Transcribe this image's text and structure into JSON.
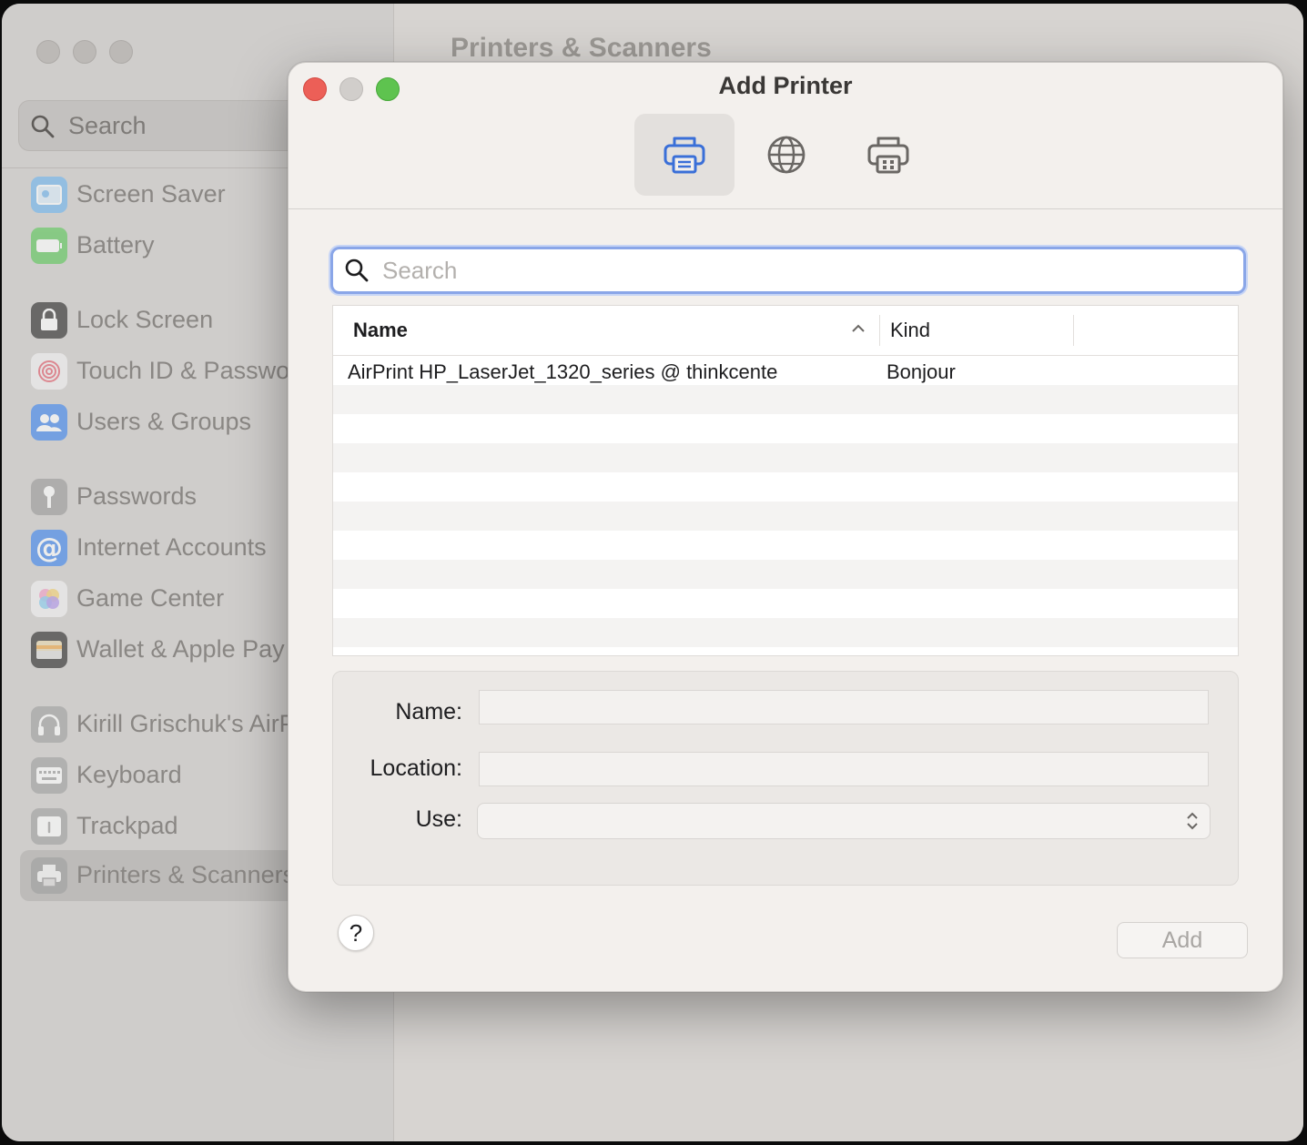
{
  "background_window": {
    "title": "Printers & Scanners",
    "sidebar": {
      "search_placeholder": "Search",
      "items": [
        {
          "label": "Screen Saver",
          "icon": "screen-saver-icon",
          "color": "#6fb6f0"
        },
        {
          "label": "Battery",
          "icon": "battery-icon",
          "color": "#5cc85a"
        },
        {
          "label": "Lock Screen",
          "icon": "lock-icon",
          "color": "#2b2b2b"
        },
        {
          "label": "Touch ID & Passwo",
          "icon": "fingerprint-icon",
          "color": "#f2f2f2"
        },
        {
          "label": "Users & Groups",
          "icon": "users-icon",
          "color": "#3e86f0"
        },
        {
          "label": "Passwords",
          "icon": "key-icon",
          "color": "#9a9a9a"
        },
        {
          "label": "Internet Accounts",
          "icon": "at-icon",
          "color": "#3e86f0"
        },
        {
          "label": "Game Center",
          "icon": "game-center-icon",
          "color": "#f2f2f2"
        },
        {
          "label": "Wallet & Apple Pay",
          "icon": "wallet-icon",
          "color": "#2b2b2b"
        },
        {
          "label": "Kirill Grischuk's AirP",
          "icon": "headphones-icon",
          "color": "#a0a0a0"
        },
        {
          "label": "Keyboard",
          "icon": "keyboard-icon",
          "color": "#a0a0a0"
        },
        {
          "label": "Trackpad",
          "icon": "trackpad-icon",
          "color": "#a0a0a0"
        },
        {
          "label": "Printers & Scanners",
          "icon": "printer-icon",
          "color": "#a0a0a0",
          "selected": true
        }
      ]
    }
  },
  "dialog": {
    "title": "Add Printer",
    "toolbar": [
      {
        "name": "default",
        "icon": "printer-default-icon",
        "active": true
      },
      {
        "name": "ip",
        "icon": "globe-icon",
        "active": false
      },
      {
        "name": "windows",
        "icon": "windows-printer-icon",
        "active": false
      }
    ],
    "search_placeholder": "Search",
    "table": {
      "columns": [
        "Name",
        "Kind"
      ],
      "rows": [
        {
          "name": "AirPrint HP_LaserJet_1320_series @ thinkcente",
          "kind": "Bonjour"
        }
      ]
    },
    "form": {
      "name_label": "Name:",
      "location_label": "Location:",
      "use_label": "Use:",
      "name_value": "",
      "location_value": "",
      "use_value": ""
    },
    "help_label": "?",
    "add_label": "Add",
    "accent_color": "#3a6fd8"
  }
}
